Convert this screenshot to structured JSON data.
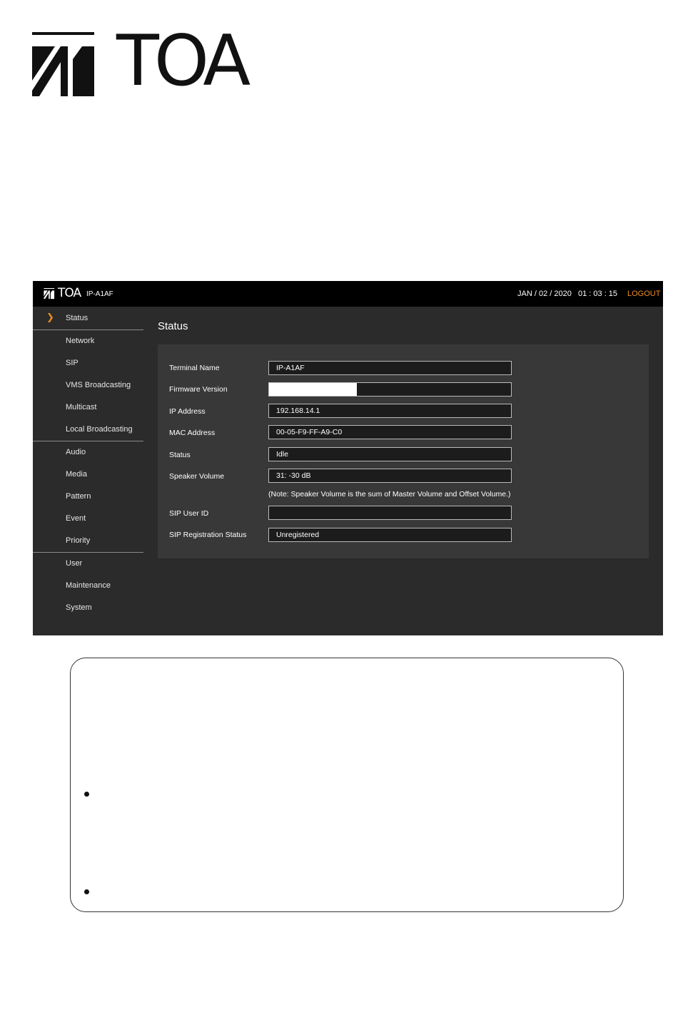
{
  "brand": {
    "name": "TOA"
  },
  "app": {
    "device_name": "IP-A1AF",
    "datetime": "JAN / 02 / 2020   01 : 03 : 15",
    "logout_label": "LOGOUT",
    "accent_color": "#f08c1e"
  },
  "sidebar": {
    "items": [
      {
        "label": "Status",
        "active": true
      },
      {
        "label": "Network"
      },
      {
        "label": "SIP"
      },
      {
        "label": "VMS Broadcasting"
      },
      {
        "label": "Multicast"
      },
      {
        "label": "Local Broadcasting"
      },
      {
        "label": "Audio"
      },
      {
        "label": "Media"
      },
      {
        "label": "Pattern"
      },
      {
        "label": "Event"
      },
      {
        "label": "Priority"
      },
      {
        "label": "User"
      },
      {
        "label": "Maintenance"
      },
      {
        "label": "System"
      }
    ]
  },
  "main": {
    "title": "Status",
    "rows": [
      {
        "label": "Terminal Name",
        "value": "IP-A1AF"
      },
      {
        "label": "Firmware Version",
        "value": ""
      },
      {
        "label": "IP Address",
        "value": "192.168.14.1"
      },
      {
        "label": "MAC Address",
        "value": "00-05-F9-FF-A9-C0"
      },
      {
        "label": "Status",
        "value": "Idle"
      },
      {
        "label": "Speaker Volume",
        "value": "31: -30 dB"
      },
      {
        "label": "SIP User ID",
        "value": ""
      },
      {
        "label": "SIP Registration Status",
        "value": "Unregistered"
      }
    ],
    "note": "(Note: Speaker Volume is the sum of Master Volume and Offset Volume.)"
  }
}
